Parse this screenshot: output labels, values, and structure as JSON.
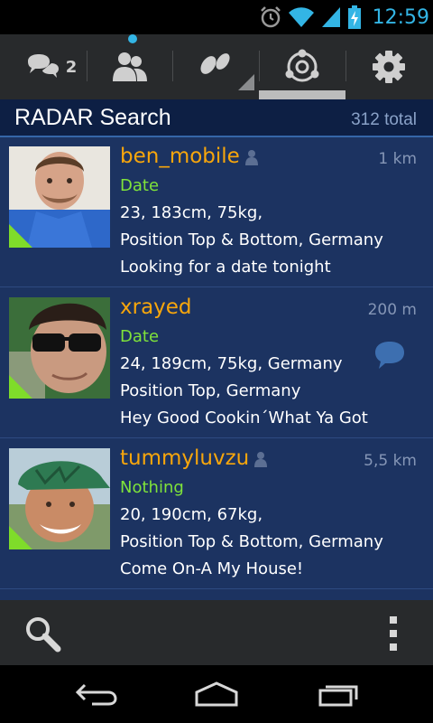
{
  "status_bar": {
    "time": "12:59",
    "icons": [
      "alarm-icon",
      "wifi-icon",
      "signal-icon",
      "battery-charging-icon"
    ]
  },
  "top_nav": {
    "chat_badge": "2",
    "items": [
      "chat-icon",
      "people-icon",
      "footprints-icon",
      "radar-icon",
      "settings-icon"
    ],
    "active": "radar-icon"
  },
  "header": {
    "title": "RADAR Search",
    "total": "312 total"
  },
  "profiles": [
    {
      "username": "ben_mobile",
      "distance": "1 km",
      "intent": "Date",
      "stats": "23, 183cm, 75kg,",
      "position": "Position Top & Bottom, Germany",
      "headline": "Looking for a date tonight",
      "has_person_icon": true,
      "has_chat_icon": false
    },
    {
      "username": "xrayed",
      "distance": "200 m",
      "intent": "Date",
      "stats": "24, 189cm, 75kg, Germany",
      "position": "Position Top, Germany",
      "headline": "Hey Good Cookin´What Ya Got",
      "has_person_icon": false,
      "has_chat_icon": true
    },
    {
      "username": "tummyluvzu",
      "distance": "5,5 km",
      "intent": "Nothing",
      "stats": "20, 190cm, 67kg,",
      "position": "Position Top & Bottom, Germany",
      "headline": "Come On-A My House!",
      "has_person_icon": true,
      "has_chat_icon": false
    }
  ],
  "colors": {
    "accent_blue": "#33b5e5",
    "username": "#f7a60c",
    "intent": "#7fe33a",
    "list_bg": "#1c3361",
    "header_bg": "#0d1f44",
    "online_corner": "#7fdc2a"
  },
  "action_bar": {
    "icons": [
      "search-icon",
      "overflow-menu-icon"
    ]
  },
  "system_nav": {
    "icons": [
      "back-icon",
      "home-icon",
      "recents-icon"
    ]
  }
}
